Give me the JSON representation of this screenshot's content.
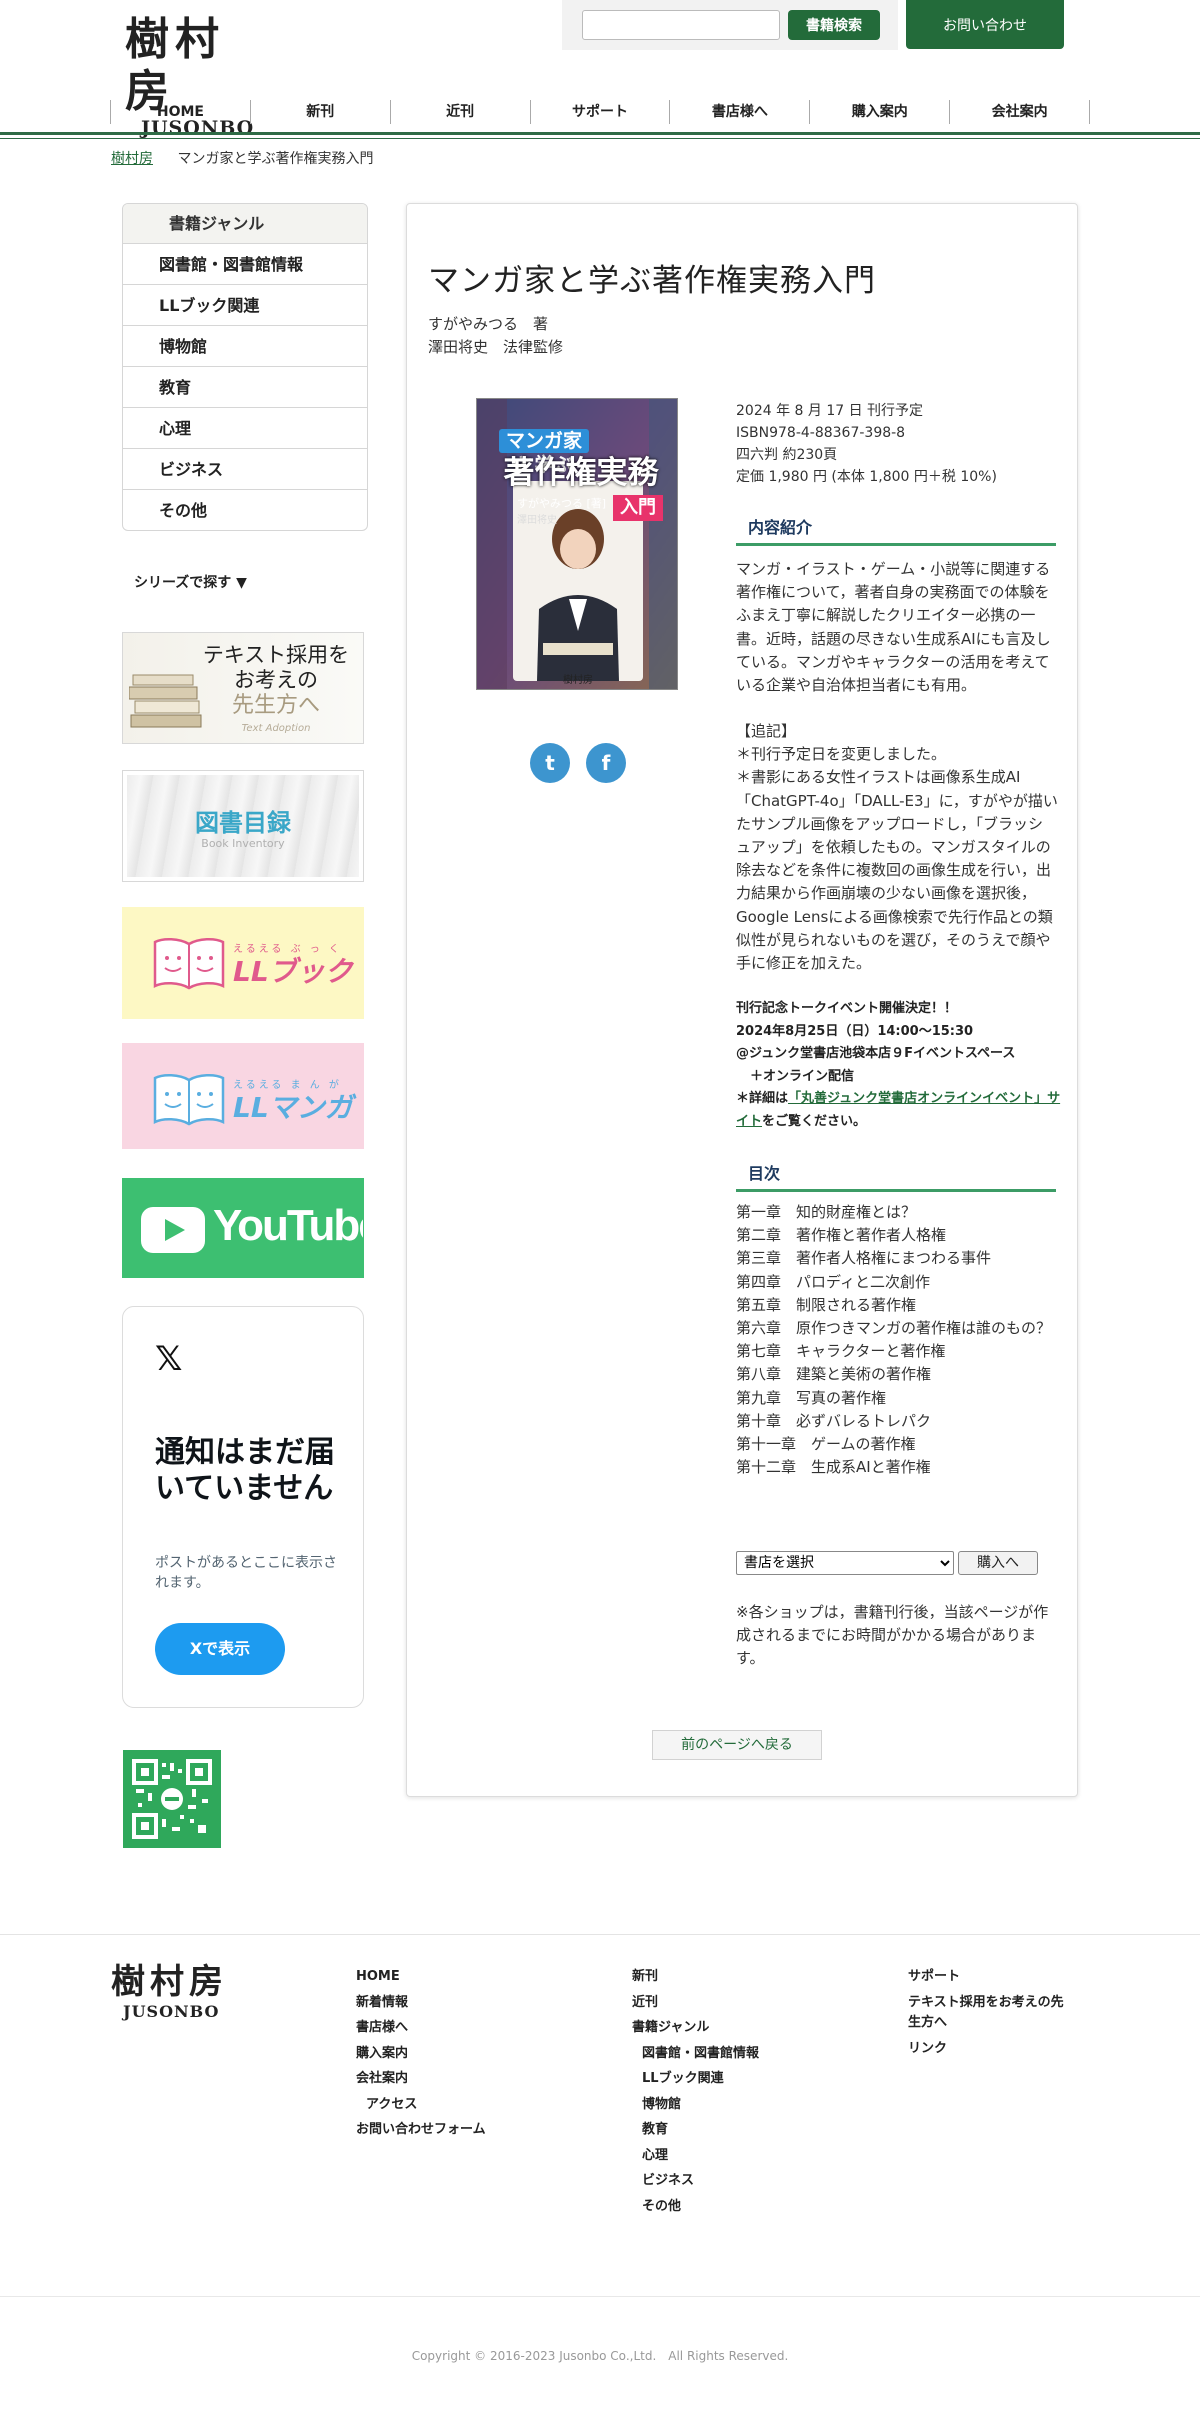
{
  "header": {
    "logo_kanji": "樹村房",
    "logo_roman": "JUSONBO",
    "search_placeholder": "",
    "search_button": "書籍検索",
    "contact_button": "お問い合わせ"
  },
  "nav": [
    "HOME",
    "新刊",
    "近刊",
    "サポート",
    "書店様へ",
    "購入案内",
    "会社案内"
  ],
  "breadcrumb": {
    "home": "樹村房",
    "current": "マンガ家と学ぶ著作権実務入門"
  },
  "sidebar": {
    "genre_title": "書籍ジャンル",
    "genres": [
      "図書館・図書館情報",
      "LLブック関連",
      "博物館",
      "教育",
      "心理",
      "ビジネス",
      "その他"
    ],
    "series_link": "シリーズで探す ▼",
    "banner_text_adoption": {
      "line1": "テキスト採用を",
      "line2": "お考えの",
      "line3": "先生方へ",
      "sub": "Text Adoption"
    },
    "banner_catalog": {
      "title": "図書目録",
      "sub": "Book Inventory"
    },
    "banner_llbook": {
      "ruby": "えるえる ぶ っ く",
      "title": "LLブック"
    },
    "banner_llmanga": {
      "ruby": "えるえる ま ん が",
      "title": "LLマンガ"
    },
    "banner_youtube": "YouTube",
    "x_widget": {
      "logo": "𝕏",
      "heading": "通知はまだ届いていません",
      "sub": "ポストがあるとここに表示されます。",
      "button": "Xで表示"
    }
  },
  "book": {
    "title": "マンガ家と学ぶ著作権実務入門",
    "author1": "すがやみつる　著",
    "author2": "澤田将史　法律監修",
    "cover": {
      "top_line": "マンガ家と学ぶ",
      "main_line": "著作権実務",
      "tag": "入門",
      "author_small": "すがやみつる",
      "author_role": "[著]",
      "supervisor": "澤田将史",
      "publisher": "樹村房"
    },
    "share": {
      "twitter": "t",
      "facebook": "f"
    },
    "meta": [
      "2024 年 8 月 17 日 刊行予定",
      "ISBN978-4-88367-398-8",
      "四六判 約230頁",
      "定価 1,980 円 (本体 1,800 円＋税 10%)"
    ],
    "section_summary": "内容紹介",
    "summary": "マンガ・イラスト・ゲーム・小説等に関連する著作権について，著者自身の実務面での体験をふまえ丁寧に解説したクリエイター必携の一書。近時，話題の尽きない生成系AIにも言及している。マンガやキャラクターの活用を考えている企業や自治体担当者にも有用。",
    "addendum_title": "【追記】",
    "addendum": [
      "＊刊行予定日を変更しました。",
      "＊書影にある女性イラストは画像系生成AI「ChatGPT-4o」「DALL-E3」に，すがやが描いたサンプル画像をアップロードし，「ブラッシュアップ」を依頼したもの。マンガスタイルの除去などを条件に複数回の画像生成を行い，出力結果から作画崩壊の少ない画像を選択後，Google Lensによる画像検索で先行作品との類似性が見られないものを選び，そのうえで顔や手に修正を加えた。"
    ],
    "event": {
      "line1": "刊行記念トークイベント開催決定！！",
      "line2": "2024年8月25日（日）14:00〜15:30",
      "line3": "@ジュンク堂書店池袋本店９Fイベントスペース",
      "line4": "＋オンライン配信",
      "detail_prefix": "＊詳細は",
      "detail_link": "「丸善ジュンク堂書店オンラインイベント」サイト",
      "detail_suffix": "をご覧ください。"
    },
    "section_toc": "目次",
    "toc": [
      "第一章　知的財産権とは？",
      "第二章　著作権と著作者人格権",
      "第三章　著作者人格権にまつわる事件",
      "第四章　パロディと二次創作",
      "第五章　制限される著作権",
      "第六章　原作つきマンガの著作権は誰のもの？",
      "第七章　キャラクターと著作権",
      "第八章　建築と美術の著作権",
      "第九章　写真の著作権",
      "第十章　必ずバレるトレパク",
      "第十一章　ゲームの著作権",
      "第十二章　生成系AIと著作権"
    ],
    "shop_select": "書店を選択",
    "buy_button": "購入へ",
    "note": "※各ショップは，書籍刊行後，当該ページが作成されるまでにお時間がかかる場合があります。",
    "back_button": "前のページへ戻る"
  },
  "footer": {
    "col1": [
      "HOME",
      "新着情報",
      "書店様へ",
      "購入案内",
      "会社案内",
      "アクセス",
      "お問い合わせフォーム"
    ],
    "col2_top": [
      "新刊",
      "近刊"
    ],
    "col2_genre_title": "書籍ジャンル",
    "col2_genres": [
      "図書館・図書館情報",
      "LLブック関連",
      "博物館",
      "教育",
      "心理",
      "ビジネス",
      "その他"
    ],
    "col3": [
      "サポート",
      "テキスト採用をお考えの先生方へ",
      "リンク"
    ],
    "copyright": "Copyright © 2016-2023 Jusonbo Co.,Ltd.　All Rights Reserved."
  },
  "colors": {
    "brand_green": "#236b3a",
    "accent_green": "#3c9c66",
    "x_blue": "#1d9bf0",
    "youtube_green": "#3dbf71"
  }
}
